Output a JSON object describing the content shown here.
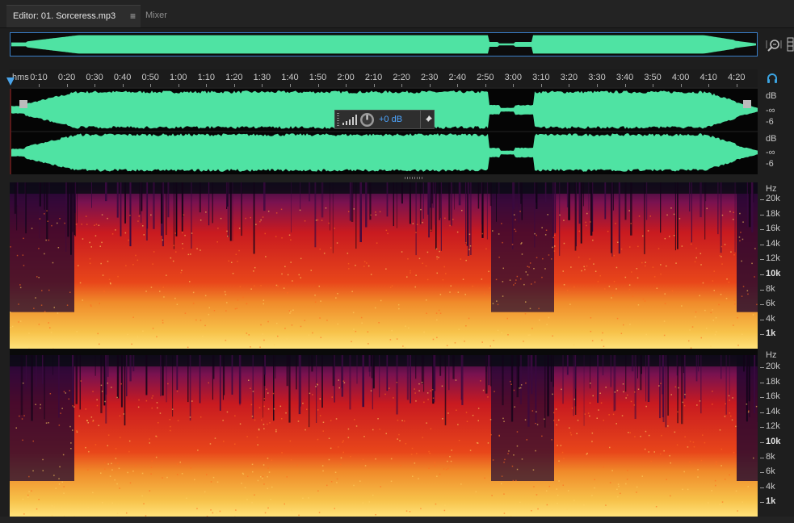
{
  "tabs": {
    "editor_label": "Editor: 01. Sorceress.mp3",
    "mixer_label": "Mixer",
    "menu_glyph": "≡"
  },
  "icons": {
    "zoom": "zoom-magnifier-icon",
    "headphones": "headphones-icon",
    "panel": "panel-toggle-icon",
    "pin": "pin-icon",
    "level_meter": "level-meter-icon",
    "volume_knob": "volume-knob-icon"
  },
  "colors": {
    "waveform": "#4fe3a3",
    "selection": "#3a7fc8",
    "background": "#1e1e1e",
    "accent": "#4aa3e8"
  },
  "ruler": {
    "unit_label": "hms",
    "ticks": [
      "0:10",
      "0:20",
      "0:30",
      "0:40",
      "0:50",
      "1:00",
      "1:10",
      "1:20",
      "1:30",
      "1:40",
      "1:50",
      "2:00",
      "2:10",
      "2:20",
      "2:30",
      "2:40",
      "2:50",
      "3:00",
      "3:10",
      "3:20",
      "3:30",
      "3:40",
      "3:50",
      "4:00",
      "4:10",
      "4:20"
    ]
  },
  "waveform": {
    "db_scale": {
      "top_channel": [
        "dB",
        "-∞",
        "-6"
      ],
      "bottom_channel": [
        "dB",
        "-∞",
        "-6"
      ]
    }
  },
  "hud": {
    "volume_value": "+0 dB"
  },
  "spectral": {
    "unit": "Hz",
    "freq_labels": [
      {
        "text": "20k",
        "bold": false
      },
      {
        "text": "18k",
        "bold": false
      },
      {
        "text": "16k",
        "bold": false
      },
      {
        "text": "14k",
        "bold": false
      },
      {
        "text": "12k",
        "bold": false
      },
      {
        "text": "10k",
        "bold": true
      },
      {
        "text": "8k",
        "bold": false
      },
      {
        "text": "6k",
        "bold": false
      },
      {
        "text": "4k",
        "bold": false
      },
      {
        "text": "1k",
        "bold": true
      }
    ]
  }
}
